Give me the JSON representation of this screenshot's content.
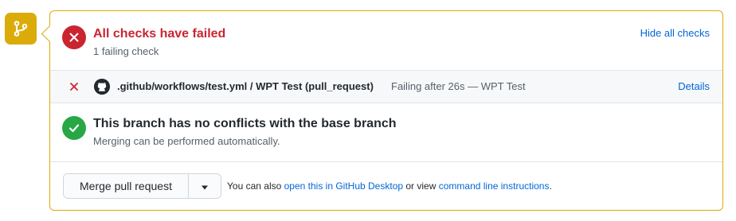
{
  "status": {
    "title": "All checks have failed",
    "subtitle": "1 failing check",
    "hide_checks_label": "Hide all checks"
  },
  "check": {
    "name": ".github/workflows/test.yml / WPT Test (pull_request)",
    "description": "Failing after 26s — WPT Test",
    "details_label": "Details"
  },
  "conflicts": {
    "title": "This branch has no conflicts with the base branch",
    "subtitle": "Merging can be performed automatically."
  },
  "merge": {
    "button_label": "Merge pull request",
    "hint_prefix": "You can also ",
    "hint_link1": "open this in GitHub Desktop",
    "hint_middle": " or view ",
    "hint_link2": "command line instructions",
    "hint_suffix": "."
  },
  "icons": {
    "branch": "git-branch-icon",
    "fail": "x-circle-icon",
    "row_fail": "x-icon",
    "github": "github-logo-icon",
    "success": "check-circle-icon",
    "dropdown": "triangle-down-icon"
  },
  "colors": {
    "warning_border": "#dbab09",
    "fail": "#cb2431",
    "success": "#28a745",
    "link": "#0366d6"
  }
}
